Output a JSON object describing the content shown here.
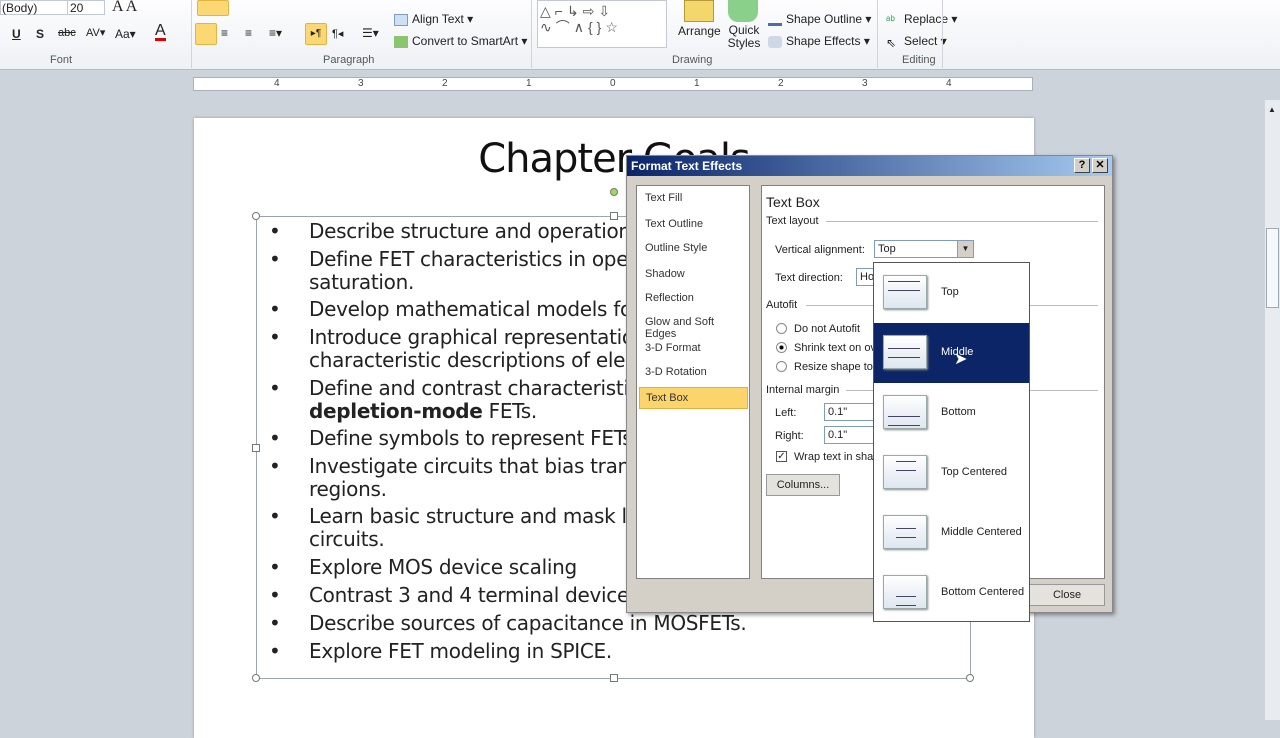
{
  "ribbon": {
    "font_name": "(Body)",
    "font_size": "20",
    "groups": {
      "font": "Font",
      "paragraph": "Paragraph",
      "drawing": "Drawing",
      "editing": "Editing"
    },
    "align_text": "Align Text",
    "convert_smartart": "Convert to SmartArt",
    "arrange": "Arrange",
    "quick_styles": "Quick Styles",
    "shape_outline": "Shape Outline",
    "shape_effects": "Shape Effects",
    "replace": "Replace",
    "select": "Select"
  },
  "ruler": {
    "marks": [
      "4",
      "3",
      "2",
      "1",
      "0",
      "1",
      "2",
      "3",
      "4"
    ]
  },
  "document": {
    "title": "Chapter Goals",
    "bullets": [
      {
        "lines": [
          "Describe structure and operation c"
        ]
      },
      {
        "lines": [
          "Define FET characteristics in operat",
          "saturation."
        ]
      },
      {
        "lines": [
          "Develop mathematical models for ,"
        ]
      },
      {
        "lines": [
          "Introduce graphical representations",
          "characteristic descriptions of electr"
        ]
      },
      {
        "lines": [
          "Define and contrast characteristics"
        ],
        "bold": "depletion-mode",
        "rest": " FETs."
      },
      {
        "lines": [
          "Define symbols to represent FETs in"
        ]
      },
      {
        "lines": [
          "Investigate circuits that bias transis",
          "regions."
        ]
      },
      {
        "lines": [
          "Learn basic structure and mask laye",
          "circuits."
        ]
      },
      {
        "lines": [
          "Explore MOS device scaling"
        ]
      },
      {
        "lines": [
          "Contrast 3 and 4 terminal device be"
        ]
      },
      {
        "lines": [
          "Describe sources of capacitance in MOSFETs."
        ]
      },
      {
        "lines": [
          "Explore FET modeling in SPICE."
        ]
      }
    ]
  },
  "dialog": {
    "title": "Format Text Effects",
    "help": "?",
    "close_x": "✕",
    "categories": [
      "Text Fill",
      "Text Outline",
      "Outline Style",
      "Shadow",
      "Reflection",
      "Glow and Soft Edges",
      "3-D Format",
      "3-D Rotation",
      "Text Box"
    ],
    "selected_category": "Text Box",
    "panel_title": "Text Box",
    "text_layout": "Text layout",
    "vertical_alignment_label": "Vertical alignment:",
    "vertical_alignment_value": "Top",
    "text_direction_label": "Text direction:",
    "text_direction_value": "Ho",
    "autofit": "Autofit",
    "autofit_options": [
      "Do not Autofit",
      "Shrink text on ov",
      "Resize shape to"
    ],
    "autofit_selected": 1,
    "internal_margin": "Internal margin",
    "left_label": "Left:",
    "left_value": "0.1\"",
    "right_label": "Right:",
    "right_value": "0.1\"",
    "wrap_text": "Wrap text in sha",
    "wrap_checked": true,
    "columns": "Columns...",
    "close": "Close"
  },
  "dropdown": {
    "options": [
      "Top",
      "Middle",
      "Bottom",
      "Top Centered",
      "Middle Centered",
      "Bottom Centered"
    ],
    "highlighted": "Middle"
  },
  "colors": {
    "highlight": "#0c2566",
    "selected_tab": "#fbd46b",
    "title_bar": "#0a246a"
  }
}
